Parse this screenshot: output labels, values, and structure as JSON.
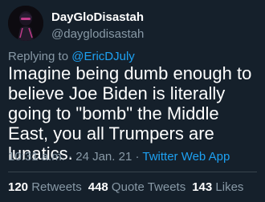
{
  "user": {
    "display_name": "DayGloDisastah",
    "handle": "@dayglodisastah"
  },
  "reply": {
    "prefix": "Replying to ",
    "mention": "@EricDJuly"
  },
  "tweet": {
    "text": "Imagine being dumb enough to believe Joe Biden is literally going to \"bomb\" the Middle East, you all Trumpers are lunatics."
  },
  "meta": {
    "time": "10:31 a.m.",
    "separator1": " · ",
    "date": "24 Jan. 21",
    "separator2": " · ",
    "source": "Twitter Web App"
  },
  "stats": {
    "retweets_count": "120",
    "retweets_label": " Retweets",
    "quotes_count": "448",
    "quotes_label": " Quote Tweets",
    "likes_count": "143",
    "likes_label": " Likes"
  },
  "colors": {
    "background": "#15202b",
    "secondary_text": "#8899a6",
    "accent": "#1da1f2",
    "divider": "#38444d"
  }
}
